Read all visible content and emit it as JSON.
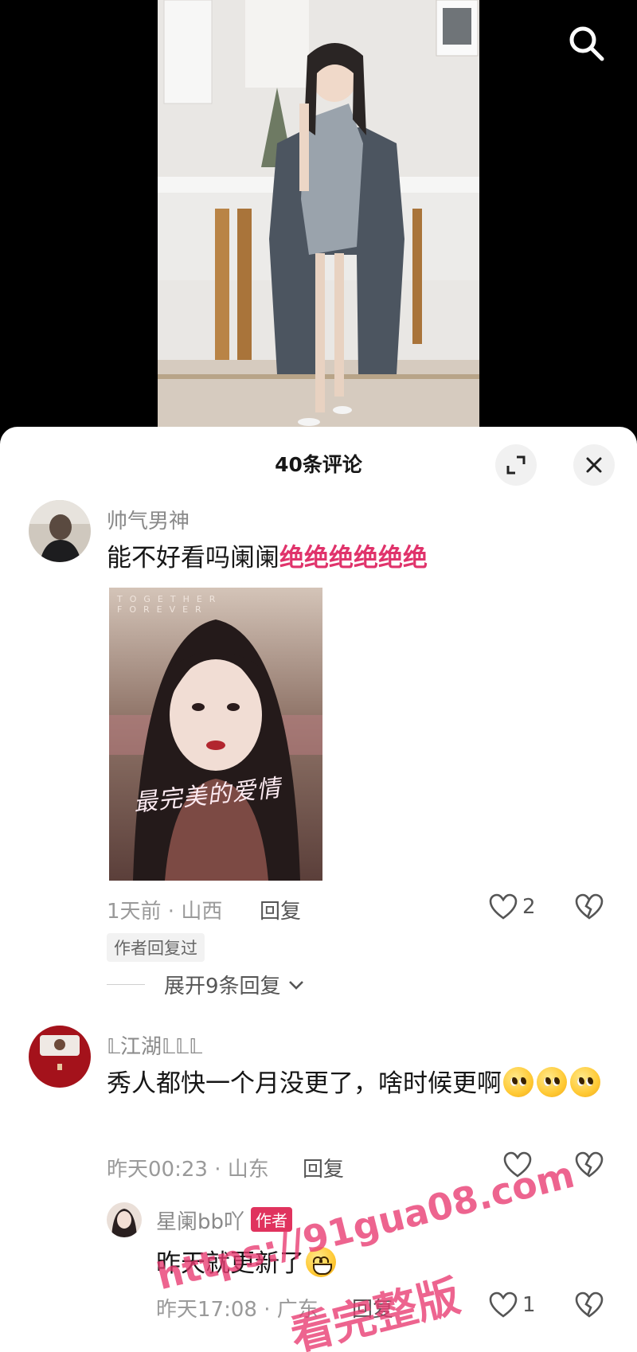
{
  "header": {
    "title": "40条评论"
  },
  "comments": [
    {
      "username": "帅气男神",
      "text": "能不好看吗阑阑",
      "highlight": "绝绝绝绝绝绝",
      "image": {
        "top_text": "TOGETHER FOREVER",
        "title": "最完美的爱情"
      },
      "time_location": "1天前 · 山西",
      "reply_label": "回复",
      "likes": "2",
      "badge": "作者回复过",
      "expand_label": "展开9条回复"
    },
    {
      "username": "𝕃江湖𝕃𝕃𝕃",
      "text": "秀人都快一个月没更了，啥时候更啊",
      "time_location": "昨天00:23 · 山东",
      "reply_label": "回复"
    }
  ],
  "reply": {
    "username": "星阑bb吖",
    "author_tag": "作者",
    "text": "昨天就更新了",
    "time_location": "昨天17:08 · 广东",
    "reply_label": "回复",
    "likes": "1"
  },
  "watermark": {
    "line1": "https://91gua08.com",
    "line2": "看完整版"
  },
  "colors": {
    "highlight": "#e0336b",
    "author_tag": "#e0335e",
    "watermark": "#e83870"
  }
}
